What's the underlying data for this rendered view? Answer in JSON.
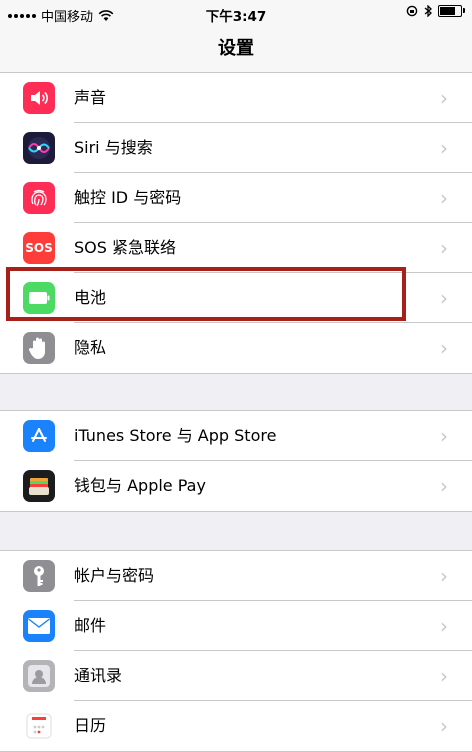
{
  "status": {
    "carrier": "中国移动",
    "time": "下午3:47",
    "battery_level": 0.85
  },
  "nav": {
    "title": "设置"
  },
  "groups": [
    {
      "items": [
        {
          "label": "声音",
          "icon": "speaker-icon",
          "color": "#fe2d55"
        },
        {
          "label": "Siri 与搜索",
          "icon": "siri-icon",
          "color": "#1c1c3a"
        },
        {
          "label": "触控 ID 与密码",
          "icon": "fingerprint-icon",
          "color": "#fe2d55"
        },
        {
          "label": "SOS 紧急联络",
          "icon": "sos-icon",
          "icon_text": "SOS",
          "color": "#fc3d39"
        },
        {
          "label": "电池",
          "icon": "battery-icon",
          "color": "#4cd964"
        },
        {
          "label": "隐私",
          "icon": "hand-icon",
          "color": "#8e8e93"
        }
      ]
    },
    {
      "items": [
        {
          "label": "iTunes Store 与 App Store",
          "icon": "appstore-icon",
          "color": "#1a82fb"
        },
        {
          "label": "钱包与 Apple Pay",
          "icon": "wallet-icon",
          "color": "#1c1c1e"
        }
      ]
    },
    {
      "items": [
        {
          "label": "帐户与密码",
          "icon": "key-icon",
          "color": "#8e8e93"
        },
        {
          "label": "邮件",
          "icon": "mail-icon",
          "color": "#1a82fb"
        },
        {
          "label": "通讯录",
          "icon": "contacts-icon",
          "color": "#b3b3b8"
        },
        {
          "label": "日历",
          "icon": "calendar-icon",
          "color": "#ffffff"
        }
      ]
    }
  ],
  "accent": "#a8201a"
}
